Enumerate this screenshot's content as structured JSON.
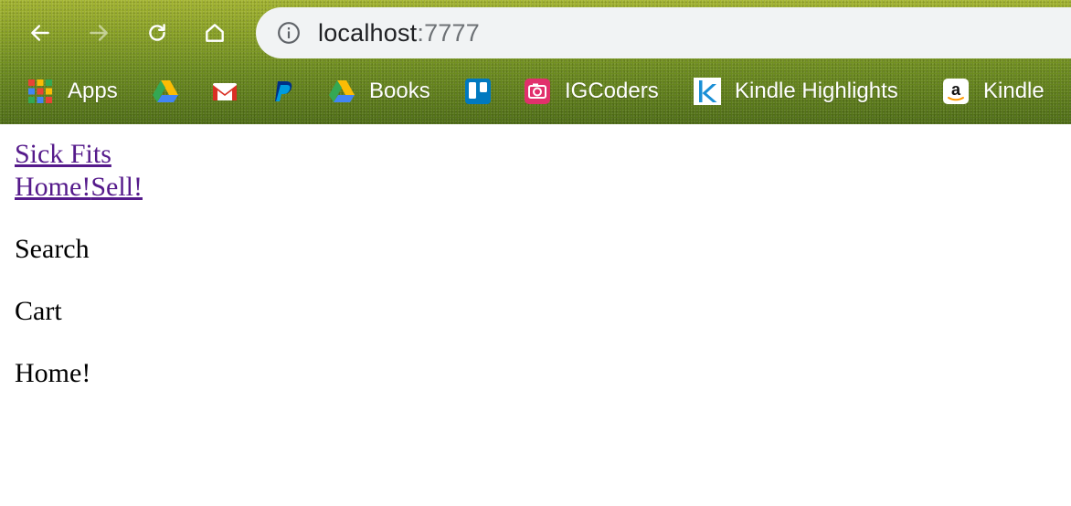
{
  "browser": {
    "url_host": "localhost",
    "url_port": ":7777",
    "icons": [
      "back-icon",
      "forward-icon",
      "reload-icon",
      "home-icon",
      "info-icon"
    ]
  },
  "bookmarks": [
    {
      "label": "Apps",
      "icon": "apps-grid-icon"
    },
    {
      "label": "",
      "icon": "google-drive-icon"
    },
    {
      "label": "",
      "icon": "gmail-icon"
    },
    {
      "label": "",
      "icon": "paypal-icon"
    },
    {
      "label": "Books",
      "icon": "google-drive-icon"
    },
    {
      "label": "",
      "icon": "trello-icon"
    },
    {
      "label": "IGCoders",
      "icon": "instagram-camera-icon"
    },
    {
      "label": "Kindle Highlights",
      "icon": "kindle-k-icon"
    },
    {
      "label": "Kindle",
      "icon": "amazon-icon"
    }
  ],
  "page": {
    "logo_text": "Sick Fits",
    "nav": {
      "home": "Home!",
      "sell": "Sell!"
    },
    "search_text": "Search",
    "cart_text": "Cart",
    "content_text": "Home!"
  },
  "colors": {
    "link_visited": "#551a8b",
    "omnibox_bg": "#f1f3f4",
    "chrome_green": "#7a951f"
  }
}
